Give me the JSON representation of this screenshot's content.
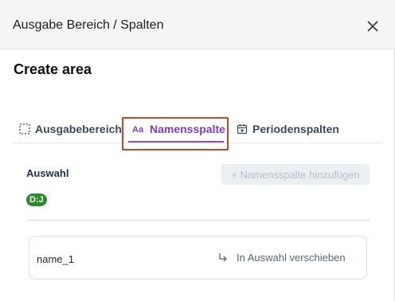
{
  "header": {
    "title": "Ausgabe Bereich / Spalten",
    "close_icon": "close-icon"
  },
  "page": {
    "title": "Create area"
  },
  "tabs": [
    {
      "label": "Ausgabebereich",
      "icon": "dashed-square-icon",
      "active": false
    },
    {
      "label": "Namensspalte",
      "icon": "text-aa-icon",
      "active": true
    },
    {
      "label": "Periodenspalten",
      "icon": "calendar-icon",
      "active": false
    }
  ],
  "selection": {
    "label": "Auswahl",
    "add_button": "+ Namensspalte hinzufügen",
    "badge": "D:J"
  },
  "items": [
    {
      "name": "name_1",
      "action": "In Auswahl verschieben",
      "action_icon": "arrow-turn-right-icon"
    }
  ],
  "colors": {
    "accent": "#7b3fc4",
    "highlight": "#c9442a",
    "badge": "#2d8a2d"
  }
}
